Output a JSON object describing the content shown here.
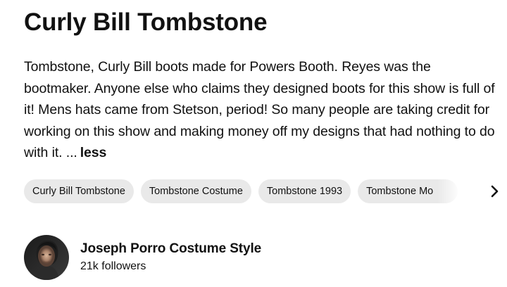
{
  "pin": {
    "title": "Curly Bill Tombstone",
    "description": "Tombstone, Curly Bill boots made for Powers Booth. Reyes was the bootmaker. Anyone else who claims they designed boots for this show is full of it! Mens hats came from Stetson, period! So many people are taking credit for working on this show and making money off my designs that had nothing to do with it. ...",
    "less_label": "less"
  },
  "tags": [
    {
      "label": "Curly Bill Tombstone"
    },
    {
      "label": "Tombstone Costume"
    },
    {
      "label": "Tombstone 1993"
    },
    {
      "label": "Tombstone Mo"
    }
  ],
  "tags_next_icon": "chevron-right-icon",
  "creator": {
    "name": "Joseph Porro Costume Style",
    "followers": "21k followers",
    "avatar_icon": "profile-photo"
  },
  "colors": {
    "text": "#111111",
    "tag_background": "#e9e9e9",
    "background": "#ffffff"
  }
}
